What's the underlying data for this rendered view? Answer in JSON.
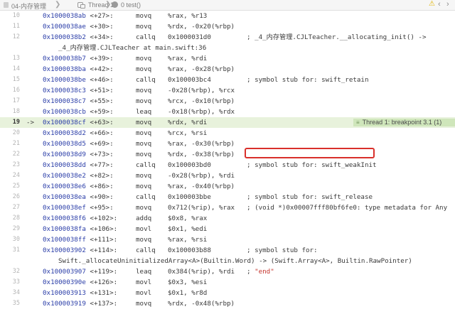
{
  "jump_bar": {
    "file": "04-内存管理",
    "thread": "Thread 1",
    "frame": "0 test()"
  },
  "breakpoint_badge": "Thread 1: breakpoint 3.1 (1)",
  "highlight": "; symbol stub for: swift_weakInit",
  "rows": [
    {
      "ln": "10",
      "addr": "0x1000038ab",
      "off": "<+27>:",
      "mn": "movq",
      "ops": "%rax, %r13"
    },
    {
      "ln": "11",
      "addr": "0x1000038ae",
      "off": "<+30>:",
      "mn": "movq",
      "ops": "%rdx, -0x20(%rbp)"
    },
    {
      "ln": "12",
      "addr": "0x1000038b2",
      "off": "<+34>:",
      "mn": "callq",
      "ops": "0x1000031d0",
      "comment": "; _4_内存管理.CJLTeacher.__allocating_init() ->"
    },
    {
      "cont": "_4_内存管理.CJLTeacher at main.swift:36"
    },
    {
      "ln": "13",
      "addr": "0x1000038b7",
      "off": "<+39>:",
      "mn": "movq",
      "ops": "%rax, %rdi"
    },
    {
      "ln": "14",
      "addr": "0x1000038ba",
      "off": "<+42>:",
      "mn": "movq",
      "ops": "%rax, -0x28(%rbp)"
    },
    {
      "ln": "15",
      "addr": "0x1000038be",
      "off": "<+46>:",
      "mn": "callq",
      "ops": "0x100003bc4",
      "comment": "; symbol stub for: swift_retain"
    },
    {
      "ln": "16",
      "addr": "0x1000038c3",
      "off": "<+51>:",
      "mn": "movq",
      "ops": "-0x28(%rbp), %rcx"
    },
    {
      "ln": "17",
      "addr": "0x1000038c7",
      "off": "<+55>:",
      "mn": "movq",
      "ops": "%rcx, -0x10(%rbp)"
    },
    {
      "ln": "18",
      "addr": "0x1000038cb",
      "off": "<+59>:",
      "mn": "leaq",
      "ops": "-0x18(%rbp), %rdx"
    },
    {
      "ln": "19",
      "arrow": "->",
      "addr": "0x1000038cf",
      "off": "<+63>:",
      "mn": "movq",
      "ops": "%rdx, %rdi",
      "current": true
    },
    {
      "ln": "20",
      "addr": "0x1000038d2",
      "off": "<+66>:",
      "mn": "movq",
      "ops": "%rcx, %rsi"
    },
    {
      "ln": "21",
      "addr": "0x1000038d5",
      "off": "<+69>:",
      "mn": "movq",
      "ops": "%rax, -0x30(%rbp)"
    },
    {
      "ln": "22",
      "addr": "0x1000038d9",
      "off": "<+73>:",
      "mn": "movq",
      "ops": "%rdx, -0x38(%rbp)"
    },
    {
      "ln": "23",
      "addr": "0x1000038dd",
      "off": "<+77>:",
      "mn": "callq",
      "ops": "0x100003bd0",
      "comment": "; symbol stub for: swift_weakInit"
    },
    {
      "ln": "24",
      "addr": "0x1000038e2",
      "off": "<+82>:",
      "mn": "movq",
      "ops": "-0x28(%rbp), %rdi"
    },
    {
      "ln": "25",
      "addr": "0x1000038e6",
      "off": "<+86>:",
      "mn": "movq",
      "ops": "%rax, -0x40(%rbp)"
    },
    {
      "ln": "26",
      "addr": "0x1000038ea",
      "off": "<+90>:",
      "mn": "callq",
      "ops": "0x100003bbe",
      "comment": "; symbol stub for: swift_release"
    },
    {
      "ln": "27",
      "addr": "0x1000038ef",
      "off": "<+95>:",
      "mn": "movq",
      "ops": "0x712(%rip), %rax",
      "comment": "; (void *)0x00007fff80bf6fe0: type metadata for Any"
    },
    {
      "ln": "28",
      "addr": "0x1000038f6",
      "off": "<+102>:",
      "mn": "addq",
      "ops": "$0x8, %rax"
    },
    {
      "ln": "29",
      "addr": "0x1000038fa",
      "off": "<+106>:",
      "mn": "movl",
      "ops": "$0x1, %edi"
    },
    {
      "ln": "30",
      "addr": "0x1000038ff",
      "off": "<+111>:",
      "mn": "movq",
      "ops": "%rax, %rsi"
    },
    {
      "ln": "31",
      "addr": "0x100003902",
      "off": "<+114>:",
      "mn": "callq",
      "ops": "0x100003b88",
      "comment": "; symbol stub for:"
    },
    {
      "cont": "Swift._allocateUninitializedArray<A>(Builtin.Word) -> (Swift.Array<A>, Builtin.RawPointer)"
    },
    {
      "ln": "32",
      "addr": "0x100003907",
      "off": "<+119>:",
      "mn": "leaq",
      "ops": "0x384(%rip), %rdi",
      "comment": "; ",
      "string": "\"end\""
    },
    {
      "ln": "33",
      "addr": "0x10000390e",
      "off": "<+126>:",
      "mn": "movl",
      "ops": "$0x3, %esi"
    },
    {
      "ln": "34",
      "addr": "0x100003913",
      "off": "<+131>:",
      "mn": "movl",
      "ops": "$0x1, %r8d"
    },
    {
      "ln": "35",
      "addr": "0x100003919",
      "off": "<+137>:",
      "mn": "movq",
      "ops": "%rdx, -0x48(%rbp)"
    }
  ]
}
